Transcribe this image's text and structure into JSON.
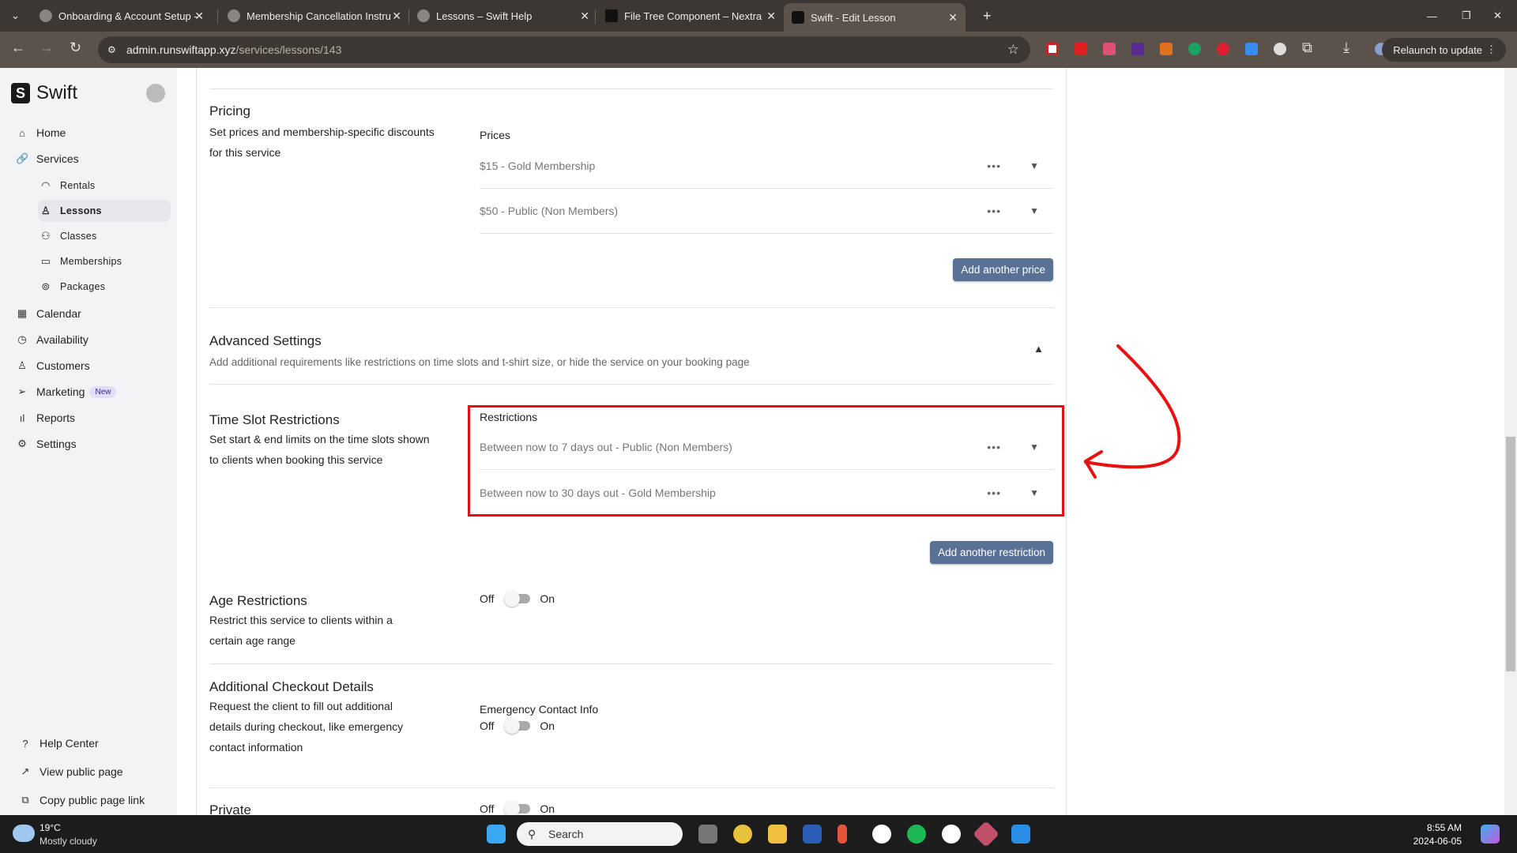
{
  "browser": {
    "tabs": [
      {
        "title": "Onboarding & Account Setup -"
      },
      {
        "title": "Membership Cancellation Instru"
      },
      {
        "title": "Lessons – Swift Help"
      },
      {
        "title": "File Tree Component – Nextra"
      },
      {
        "title": "Swift - Edit Lesson",
        "active": true
      }
    ],
    "url_host": "admin.runswiftapp.xyz",
    "url_path": "/services/lessons/143",
    "relaunch": "Relaunch to update"
  },
  "sidebar": {
    "brand": "Swift",
    "items": [
      {
        "label": "Home",
        "icon": "⌂"
      },
      {
        "label": "Services",
        "icon": "🔗"
      }
    ],
    "sub": [
      {
        "label": "Rentals",
        "icon": "◠"
      },
      {
        "label": "Lessons",
        "icon": "♙",
        "active": true
      },
      {
        "label": "Classes",
        "icon": "⚇"
      },
      {
        "label": "Memberships",
        "icon": "▭"
      },
      {
        "label": "Packages",
        "icon": "⊚"
      }
    ],
    "items2": [
      {
        "label": "Calendar",
        "icon": "▦"
      },
      {
        "label": "Availability",
        "icon": "◷"
      },
      {
        "label": "Customers",
        "icon": "♙"
      },
      {
        "label": "Marketing",
        "icon": "➢",
        "badge": "New"
      },
      {
        "label": "Reports",
        "icon": "ıl"
      },
      {
        "label": "Settings",
        "icon": "⚙"
      }
    ],
    "footer": [
      {
        "label": "Help Center",
        "icon": "?"
      },
      {
        "label": "View public page",
        "icon": "↗"
      },
      {
        "label": "Copy public page link",
        "icon": "⧉"
      }
    ]
  },
  "pricing": {
    "title": "Pricing",
    "desc": "Set prices and membership-specific discounts for this service",
    "label": "Prices",
    "rows": [
      "$15 - Gold Membership",
      "$50 - Public (Non Members)"
    ],
    "button": "Add another price"
  },
  "advanced": {
    "title": "Advanced Settings",
    "desc": "Add additional requirements like restrictions on time slots and t-shirt size, or hide the service on your booking page"
  },
  "timeslot": {
    "title": "Time Slot Restrictions",
    "desc": "Set start & end limits on the time slots shown to clients when booking this service",
    "label": "Restrictions",
    "rows": [
      "Between now to 7 days out - Public (Non Members)",
      "Between now to 30 days out - Gold Membership"
    ],
    "button": "Add another restriction"
  },
  "age": {
    "title": "Age Restrictions",
    "desc": "Restrict this service to clients within a certain age range",
    "off": "Off",
    "on": "On"
  },
  "checkout": {
    "title": "Additional Checkout Details",
    "desc": "Request the client to fill out additional details during checkout, like emergency contact information",
    "field": "Emergency Contact Info",
    "off": "Off",
    "on": "On"
  },
  "private": {
    "title": "Private",
    "off": "Off",
    "on": "On"
  },
  "more_icon": "•••",
  "chevron_down": "⌄",
  "chevron_up": "⌃",
  "taskbar": {
    "temp": "19°C",
    "weather": "Mostly cloudy",
    "search": "Search",
    "time": "8:55 AM",
    "date": "2024-06-05"
  }
}
